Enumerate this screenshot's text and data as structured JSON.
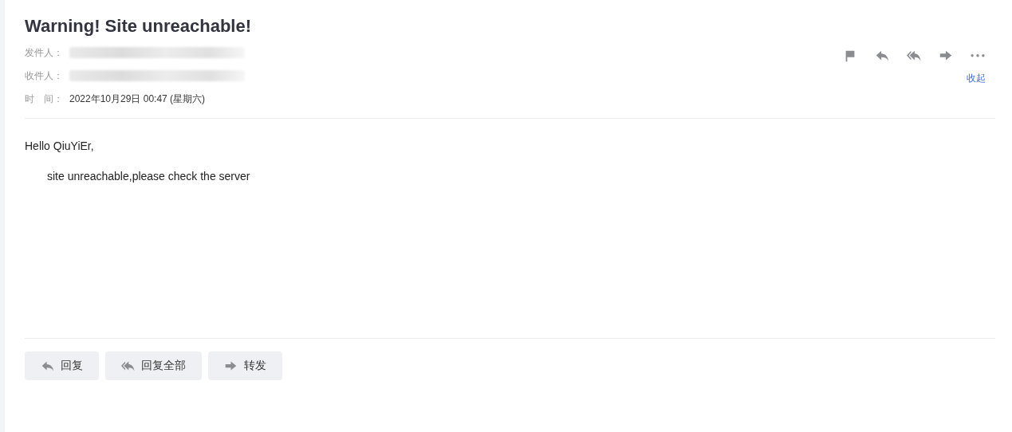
{
  "subject": "Warning! Site unreachable!",
  "header_fields": [
    {
      "label": "发件人：",
      "kind": "redacted"
    },
    {
      "label": "收件人：",
      "kind": "redacted"
    },
    {
      "label": "时　间：",
      "kind": "text",
      "value": "2022年10月29日 00:47 (星期六)"
    }
  ],
  "collapse_link": "收起",
  "body": {
    "greeting": "Hello QiuYiEr,",
    "paragraph": "site unreachable,please check the server"
  },
  "footer_buttons": [
    {
      "kind": "reply",
      "label": "回复"
    },
    {
      "kind": "reply_all",
      "label": "回复全部"
    },
    {
      "kind": "forward",
      "label": "转发"
    }
  ]
}
